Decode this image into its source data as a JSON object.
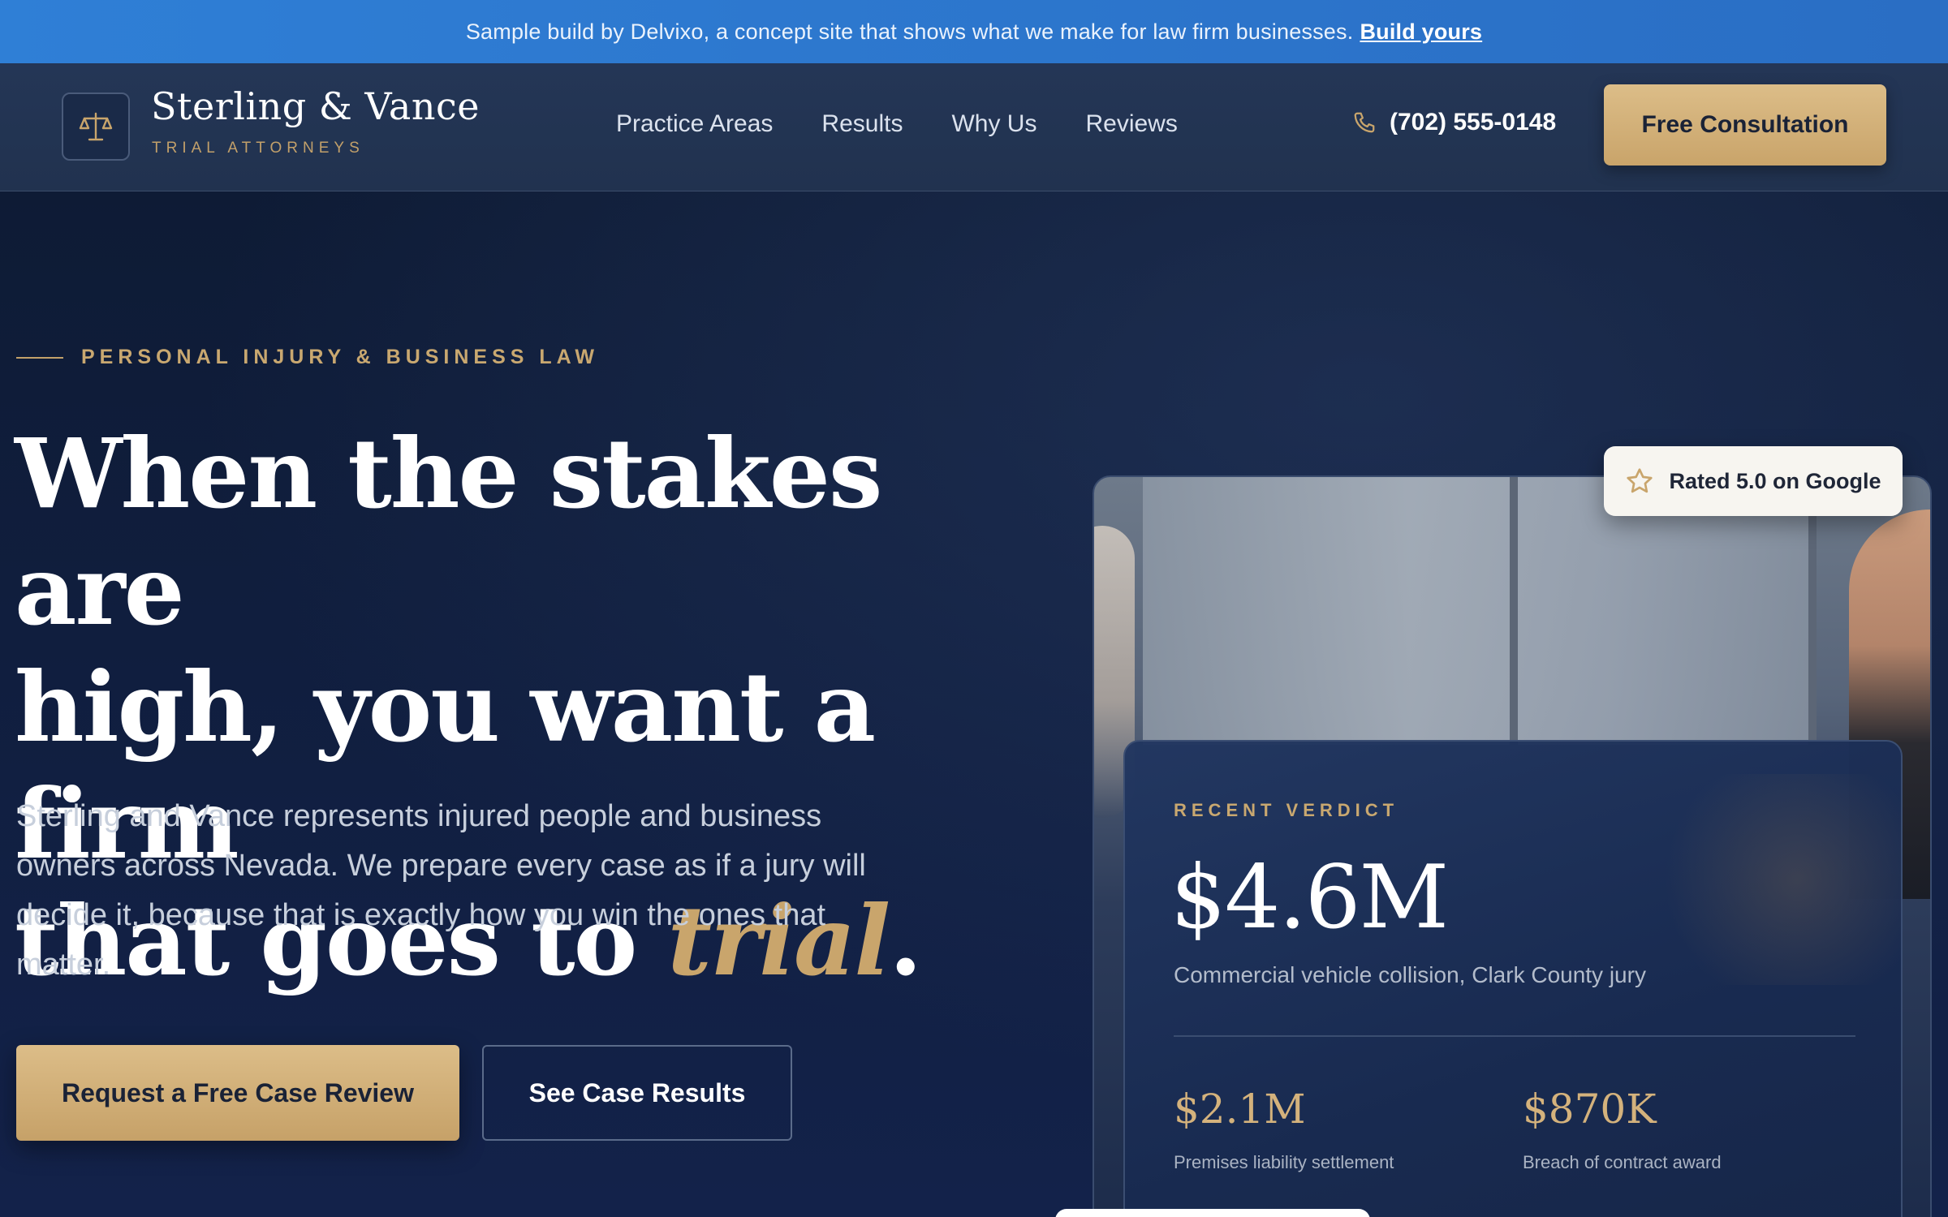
{
  "banner": {
    "text": "Sample build by Delvixo, a concept site that shows what we make for law firm businesses.",
    "link": "Build yours"
  },
  "header": {
    "logo_name": "Sterling & Vance",
    "logo_tagline": "TRIAL ATTORNEYS",
    "nav": [
      "Practice Areas",
      "Results",
      "Why Us",
      "Reviews"
    ],
    "phone": "(702) 555-0148",
    "cta": "Free Consultation"
  },
  "hero": {
    "eyebrow": "PERSONAL INJURY & BUSINESS LAW",
    "headline_line1": "When the stakes are",
    "headline_line2": "high, you want a firm",
    "headline_line3_pre": "that goes to ",
    "headline_emphasis": "trial",
    "headline_end": ".",
    "lede": "Sterling and Vance represents injured people and business owners across Nevada. We prepare every case as if a jury will decide it, because that is exactly how you win the ones that matter.",
    "primary_cta": "Request a Free Case Review",
    "secondary_cta": "See Case Results"
  },
  "rating": {
    "text": "Rated 5.0 on Google"
  },
  "verdict": {
    "label": "RECENT VERDICT",
    "amount": "$4.6M",
    "description": "Commercial vehicle collision, Clark County jury",
    "stats": [
      {
        "amount": "$2.1M",
        "label": "Premises liability settlement"
      },
      {
        "amount": "$870K",
        "label": "Breach of contract award"
      }
    ]
  },
  "colors": {
    "banner": "#2f7fd6",
    "navy": "#0f1d38",
    "gold": "#c9a56c",
    "header": "#243656"
  },
  "icons": {
    "logo": "scales-of-justice-icon",
    "phone": "phone-icon",
    "rating": "star-icon"
  }
}
